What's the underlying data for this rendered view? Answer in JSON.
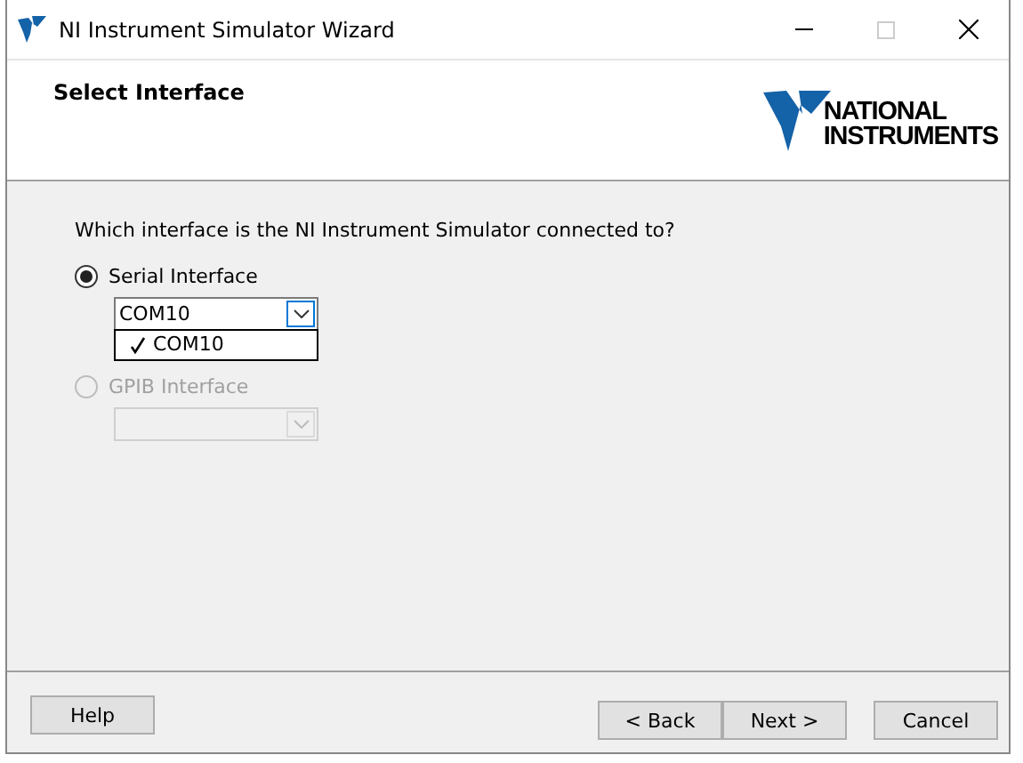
{
  "window": {
    "title": "NI Instrument Simulator Wizard"
  },
  "header": {
    "title": "Select Interface",
    "logo": [
      "NATIONAL",
      "INSTRUMENTS"
    ]
  },
  "question": "Which interface is the NI Instrument Simulator connected to?",
  "options": [
    {
      "label": "Serial Interface",
      "selected": true,
      "disabled": false,
      "combo": {
        "value": "COM10",
        "open": true,
        "items": [
          {
            "label": "COM10",
            "checked": true
          }
        ]
      }
    },
    {
      "label": "GPIB Interface",
      "selected": false,
      "disabled": true,
      "combo": {
        "open": false
      }
    }
  ],
  "buttons": [
    {
      "label": "Help",
      "kind": "left"
    },
    {
      "label": "< Back",
      "kind": "right"
    },
    {
      "label": "Next >",
      "kind": "right"
    },
    {
      "label": "Cancel",
      "kind": "far"
    }
  ]
}
